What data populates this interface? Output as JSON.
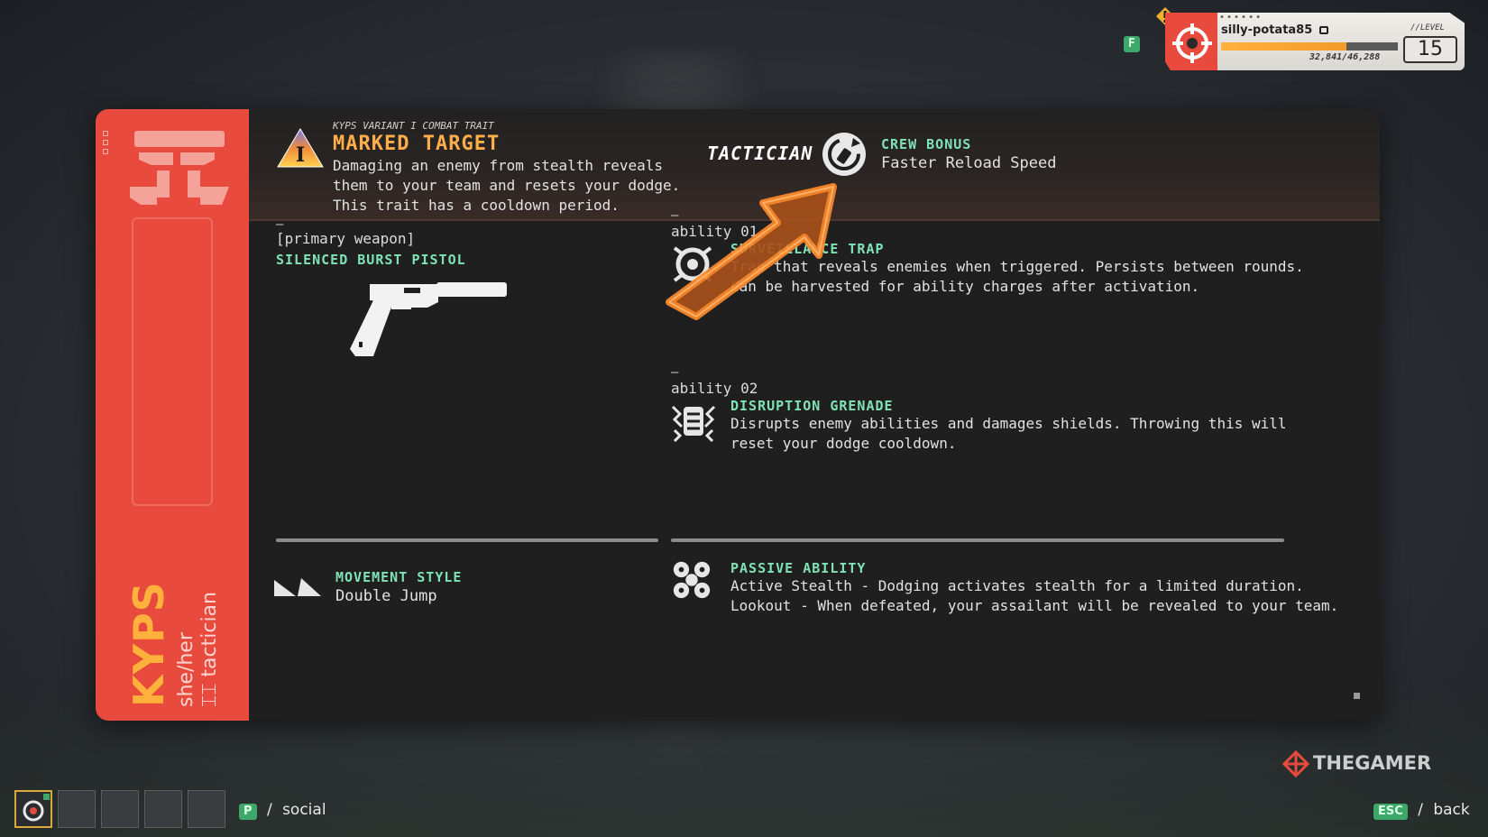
{
  "character": {
    "name": "KYPS",
    "pronouns": "she/her",
    "role": "tactician",
    "role_glyph": "⌶⌶"
  },
  "trait": {
    "variant": "KYPS VARIANT I COMBAT TRAIT",
    "numeral": "I",
    "title": "MARKED TARGET",
    "description": "Damaging an enemy from stealth reveals them to your team and resets your dodge. This trait has a cooldown period."
  },
  "crew": {
    "class_label": "TACTICIAN",
    "title": "CREW BONUS",
    "value": "Faster Reload Speed"
  },
  "weapon": {
    "dash": "–",
    "slot_label": "[primary weapon]",
    "name": "SILENCED BURST PISTOL"
  },
  "abilities": [
    {
      "dash": "–",
      "label": "ability 01",
      "title": "SURVEILLANCE TRAP",
      "description": "Trap that reveals enemies when triggered. Persists between rounds. Can be harvested for ability charges after activation.",
      "icon": "trap-icon"
    },
    {
      "dash": "–",
      "label": "ability 02",
      "title": "DISRUPTION GRENADE",
      "description": "Disrupts enemy abilities and damages shields. Throwing this will reset your dodge cooldown.",
      "icon": "grenade-icon"
    }
  ],
  "movement": {
    "title": "MOVEMENT STYLE",
    "value": "Double Jump"
  },
  "passive": {
    "title": "PASSIVE ABILITY",
    "line1": "Active Stealth - Dodging activates stealth for a limited duration.",
    "line2": "Lookout - When defeated, your assailant will be revealed to your team."
  },
  "player": {
    "username": "silly-potata85",
    "xp_text": "32,841/46,288",
    "xp_fraction": 0.709,
    "level_label": "//LEVEL",
    "level": "15"
  },
  "hotkeys": {
    "f_key": "F",
    "social_key": "P",
    "social_label": "social",
    "back_key": "ESC",
    "back_label": "back",
    "separator": "/"
  },
  "watermark": "THEGAMER",
  "colors": {
    "accent_red": "#e84a3e",
    "accent_orange": "#ffae4a",
    "accent_teal": "#7fe3b6",
    "arrow_orange": "#c8641e"
  }
}
